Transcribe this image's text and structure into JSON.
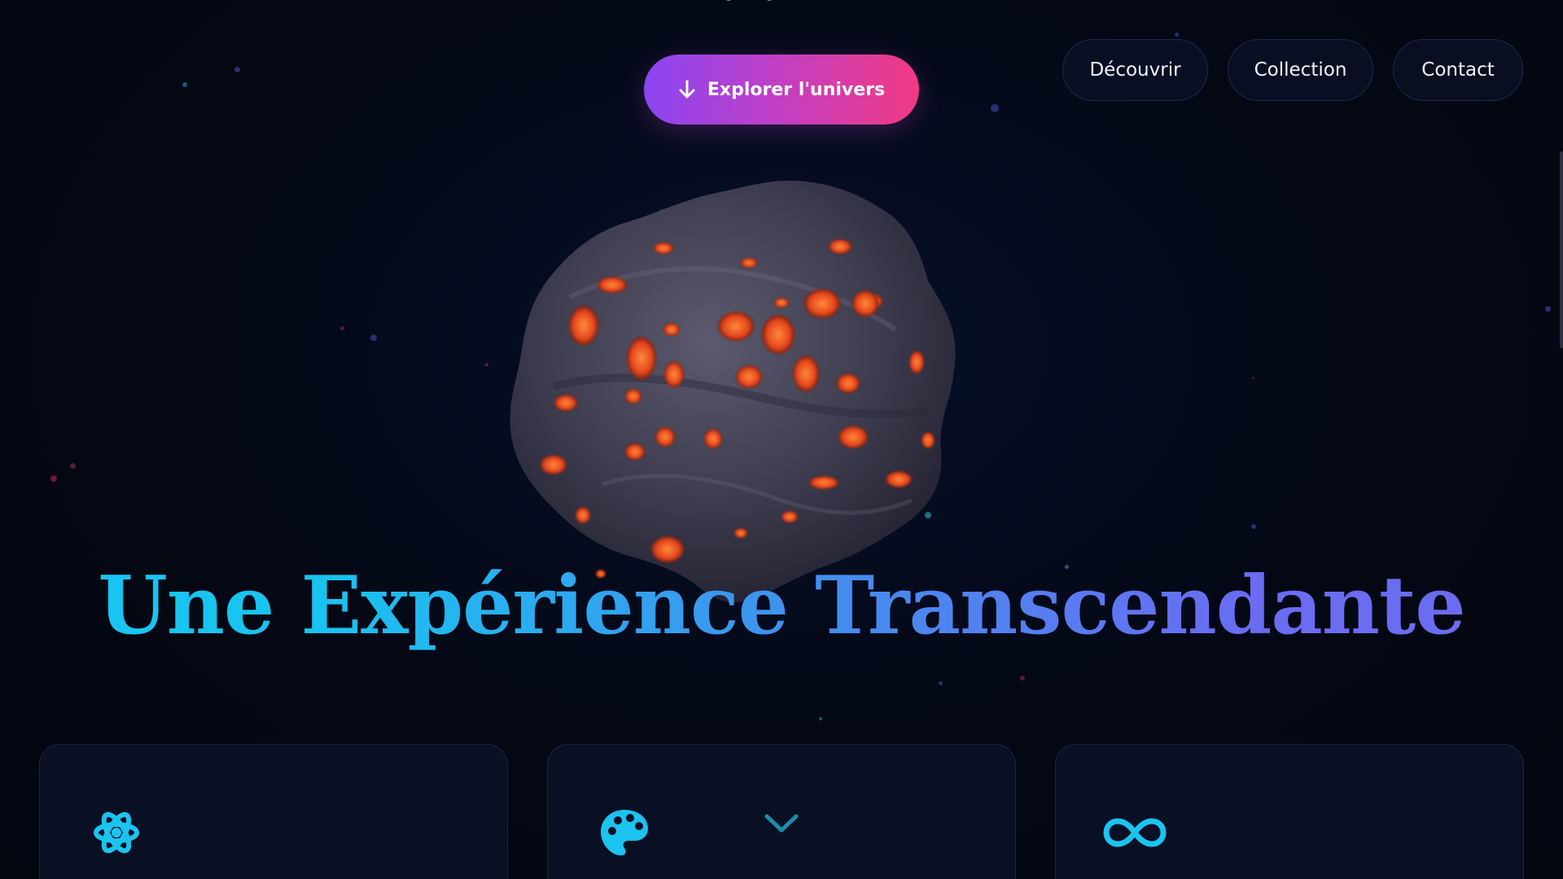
{
  "nav": {
    "items": [
      {
        "label": "Découvrir"
      },
      {
        "label": "Collection"
      },
      {
        "label": "Contact"
      }
    ]
  },
  "hero": {
    "cta_label": "Explorer l'univers",
    "cta_icon": "arrow-down-icon",
    "title": "Une Expérience Transcendante"
  },
  "features": {
    "cards": [
      {
        "icon": "atom-icon"
      },
      {
        "icon": "palette-icon"
      },
      {
        "icon": "infinity-icon"
      }
    ]
  },
  "colors": {
    "background": "#040814",
    "cta_gradient_start": "#8b45f2",
    "cta_gradient_end": "#f23a82",
    "title_gradient_start": "#18c4f0",
    "title_gradient_end": "#6a6cf2",
    "icon_accent": "#1bc3ef",
    "lava": "#ff5a1f"
  }
}
